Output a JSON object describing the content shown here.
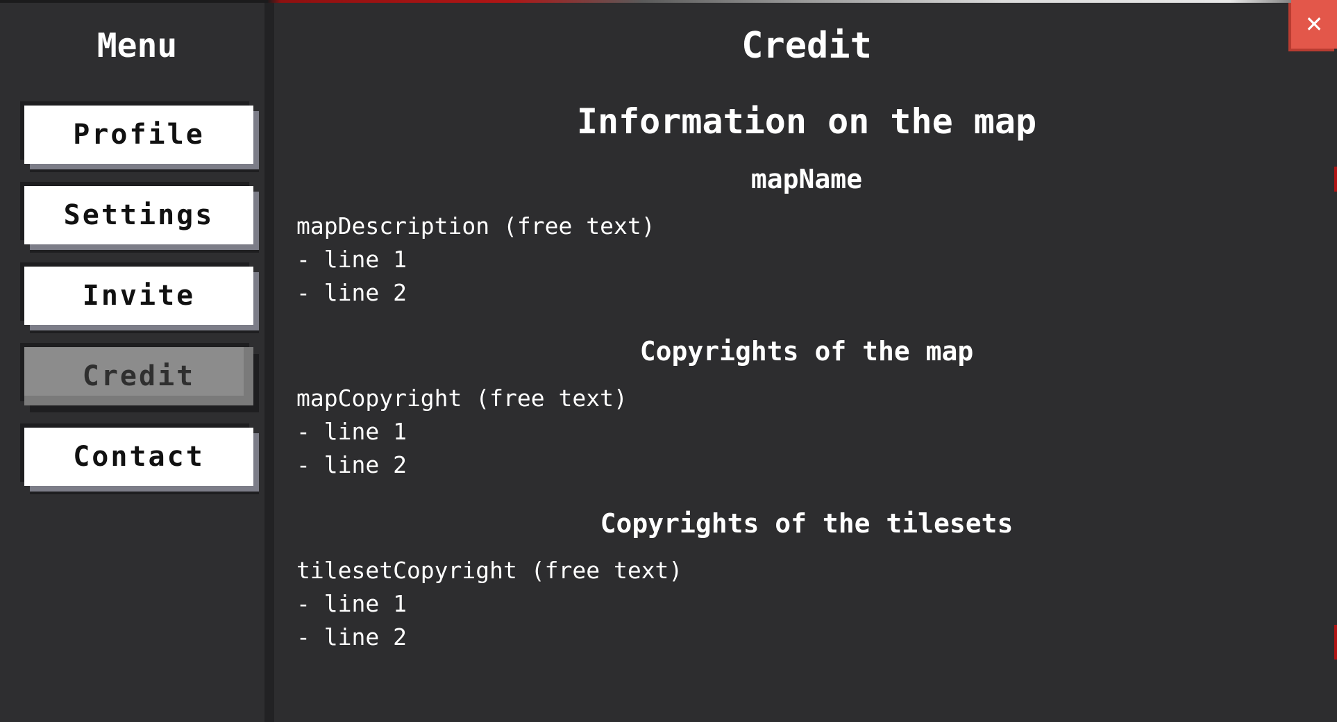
{
  "menu": {
    "title": "Menu",
    "items": [
      {
        "label": "Profile",
        "active": false
      },
      {
        "label": "Settings",
        "active": false
      },
      {
        "label": "Invite",
        "active": false
      },
      {
        "label": "Credit",
        "active": true
      },
      {
        "label": "Contact",
        "active": false
      }
    ]
  },
  "close": {
    "icon": "close-icon",
    "glyph": "✕"
  },
  "content": {
    "title": "Credit",
    "sections": [
      {
        "heading": "Information on the map",
        "subheading": "mapName",
        "lines": [
          "mapDescription (free text)",
          "- line 1",
          "- line 2"
        ]
      },
      {
        "heading": "Copyrights of the map",
        "lines": [
          "mapCopyright (free text)",
          "- line 1",
          "- line 2"
        ]
      },
      {
        "heading": "Copyrights of the tilesets",
        "lines": [
          "tilesetCopyright (free text)",
          "- line 1",
          "- line 2"
        ]
      }
    ]
  },
  "colors": {
    "panel_bg": "#2d2d2f",
    "button_bg": "#ffffff",
    "button_active_bg": "#8c8c8c",
    "close_bg": "#e3574a"
  }
}
